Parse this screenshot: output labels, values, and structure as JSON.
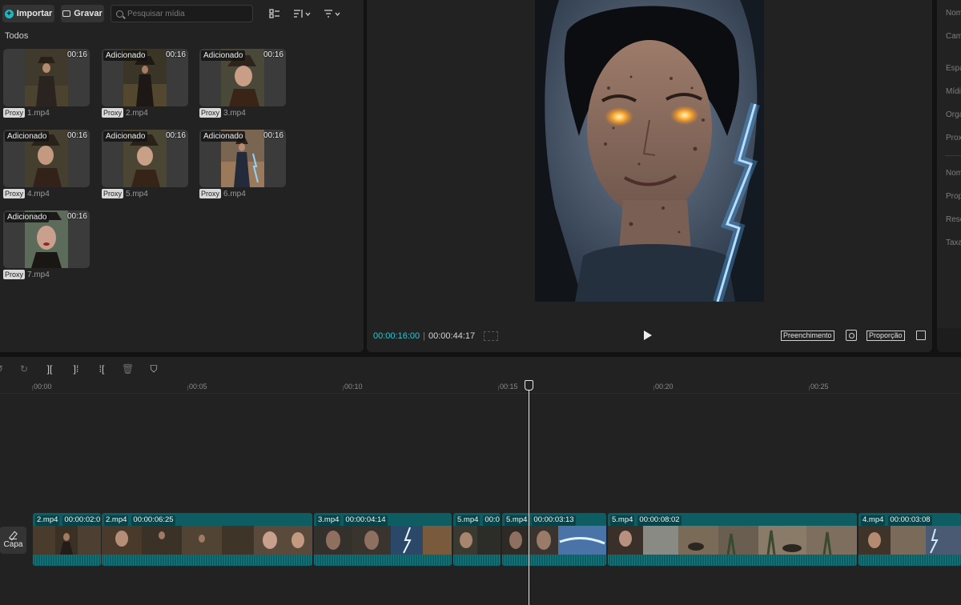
{
  "media": {
    "import_label": "Importar",
    "record_label": "Gravar",
    "search_placeholder": "Pesquisar mídia",
    "section_title": "Todos",
    "items": [
      {
        "added": "",
        "duration": "00:16",
        "proxy": "Proxy",
        "file": "1.mp4"
      },
      {
        "added": "Adicionado",
        "duration": "00:16",
        "proxy": "Proxy",
        "file": "2.mp4"
      },
      {
        "added": "Adicionado",
        "duration": "00:16",
        "proxy": "Proxy",
        "file": "3.mp4"
      },
      {
        "added": "Adicionado",
        "duration": "00:16",
        "proxy": "Proxy",
        "file": "4.mp4"
      },
      {
        "added": "Adicionado",
        "duration": "00:16",
        "proxy": "Proxy",
        "file": "5.mp4"
      },
      {
        "added": "Adicionado",
        "duration": "00:16",
        "proxy": "Proxy",
        "file": "6.mp4"
      },
      {
        "added": "Adicionado",
        "duration": "00:16",
        "proxy": "Proxy",
        "file": "7.mp4"
      }
    ]
  },
  "player": {
    "current_time": "00:00:16:00",
    "separator": "|",
    "total_time": "00:00:44:17",
    "fill_label": "Preenchimento",
    "ratio_label": "Proporção"
  },
  "properties": {
    "labels": [
      "Nom",
      "Cam",
      "Espa",
      "Mídi",
      "Orga",
      "Prox",
      "Nom",
      "Prop",
      "Reso",
      "Taxa"
    ]
  },
  "timeline": {
    "ruler": [
      "00:00",
      "00:05",
      "00:10",
      "00:15",
      "00:20",
      "00:25"
    ],
    "cover_label": "Capa",
    "clips": [
      {
        "name": "2.mp4",
        "duration": "00:00:02:0"
      },
      {
        "name": "2.mp4",
        "duration": "00:00:06:25"
      },
      {
        "name": "3.mp4",
        "duration": "00:00:04:14"
      },
      {
        "name": "5.mp4",
        "duration": "00:0"
      },
      {
        "name": "5.mp4",
        "duration": "00:00:03:13"
      },
      {
        "name": "5.mp4",
        "duration": "00:00:08:02"
      },
      {
        "name": "4.mp4",
        "duration": "00:00:03:08"
      }
    ]
  }
}
